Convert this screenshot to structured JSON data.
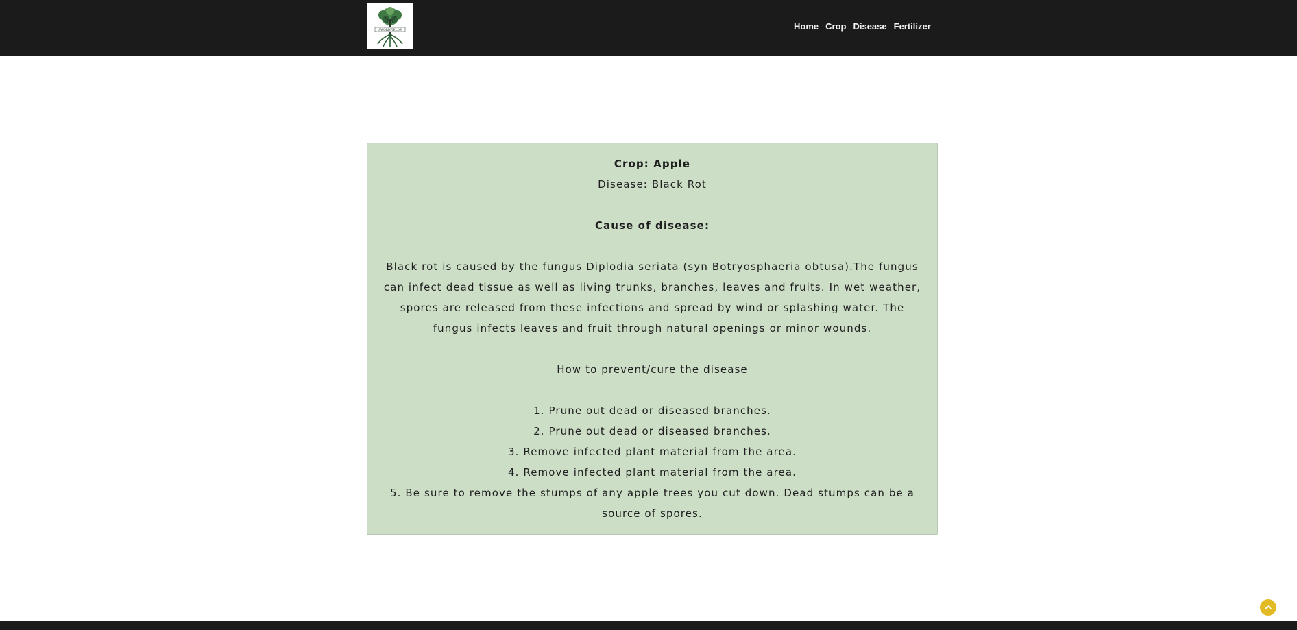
{
  "nav": {
    "logo_text": "SWORDFIELDS",
    "links": [
      "Home",
      "Crop",
      "Disease",
      "Fertilizer"
    ]
  },
  "result": {
    "crop_line": "Crop: Apple",
    "disease_line": "Disease: Black Rot",
    "cause_heading": "Cause of disease:",
    "cause_text": "Black rot is caused by the fungus Diplodia seriata (syn Botryosphaeria obtusa).The fungus can infect dead tissue as well as living trunks, branches, leaves and fruits. In wet weather, spores are released from these infections and spread by wind or splashing water. The fungus infects leaves and fruit through natural openings or minor wounds.",
    "prevent_heading": "How to prevent/cure the disease",
    "steps": [
      "1. Prune out dead or diseased branches.",
      "2. Prune out dead or diseased branches.",
      "3. Remove infected plant material from the area.",
      "4. Remove infected plant material from the area.",
      "5. Be sure to remove the stumps of any apple trees you cut down. Dead stumps can be a source of spores."
    ]
  },
  "icons": {
    "scroll_top": "chevron-up-icon",
    "logo": "tree-logo-icon"
  },
  "colors": {
    "navbar": "#1b1b1b",
    "card_bg": "#cddec7",
    "accent": "#e2bb24"
  }
}
